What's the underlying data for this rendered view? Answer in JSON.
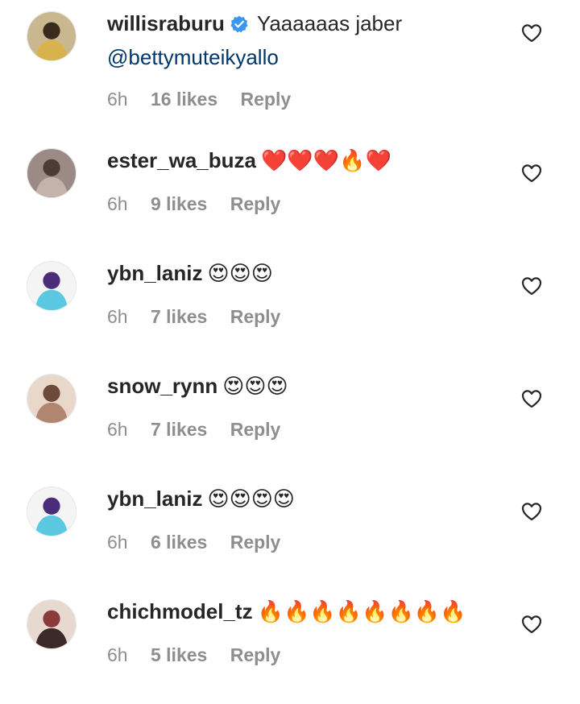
{
  "comments": [
    {
      "username": "willisraburu",
      "verified": true,
      "text": "Yaaaaaas jaber",
      "mention": "@bettymuteikyallo",
      "time": "6h",
      "likes": "16 likes",
      "reply": "Reply",
      "avatar_colors": [
        "#c9b78f",
        "#3a2a1e",
        "#d8b24a"
      ]
    },
    {
      "username": "ester_wa_buza",
      "verified": false,
      "text": "❤️❤️❤️🔥❤️",
      "mention": "",
      "time": "6h",
      "likes": "9 likes",
      "reply": "Reply",
      "avatar_colors": [
        "#9b8a86",
        "#4e3b35",
        "#c4b3a8"
      ]
    },
    {
      "username": "ybn_laniz",
      "verified": false,
      "text": "😍😍😍",
      "mention": "",
      "time": "6h",
      "likes": "7 likes",
      "reply": "Reply",
      "avatar_colors": [
        "#f4f4f4",
        "#4a2c7a",
        "#5ac8e0"
      ]
    },
    {
      "username": "snow_rynn",
      "verified": false,
      "text": "😍😍😍",
      "mention": "",
      "time": "6h",
      "likes": "7 likes",
      "reply": "Reply",
      "avatar_colors": [
        "#e9d8c9",
        "#6e4a3a",
        "#b08670"
      ]
    },
    {
      "username": "ybn_laniz",
      "verified": false,
      "text": "😍😍😍😍",
      "mention": "",
      "time": "6h",
      "likes": "6 likes",
      "reply": "Reply",
      "avatar_colors": [
        "#f4f4f4",
        "#4a2c7a",
        "#5ac8e0"
      ]
    },
    {
      "username": "chichmodel_tz",
      "verified": false,
      "text": "🔥🔥🔥🔥🔥🔥🔥🔥",
      "mention": "",
      "time": "6h",
      "likes": "5 likes",
      "reply": "Reply",
      "avatar_colors": [
        "#e7d9cf",
        "#8a3b3b",
        "#3c2a2a"
      ]
    }
  ],
  "icons": {
    "like": "heart-outline-icon",
    "verified": "verified-badge-icon"
  },
  "colors": {
    "text": "#262626",
    "meta": "#8e8e8e",
    "mention": "#00376b",
    "verified": "#3897f0"
  }
}
